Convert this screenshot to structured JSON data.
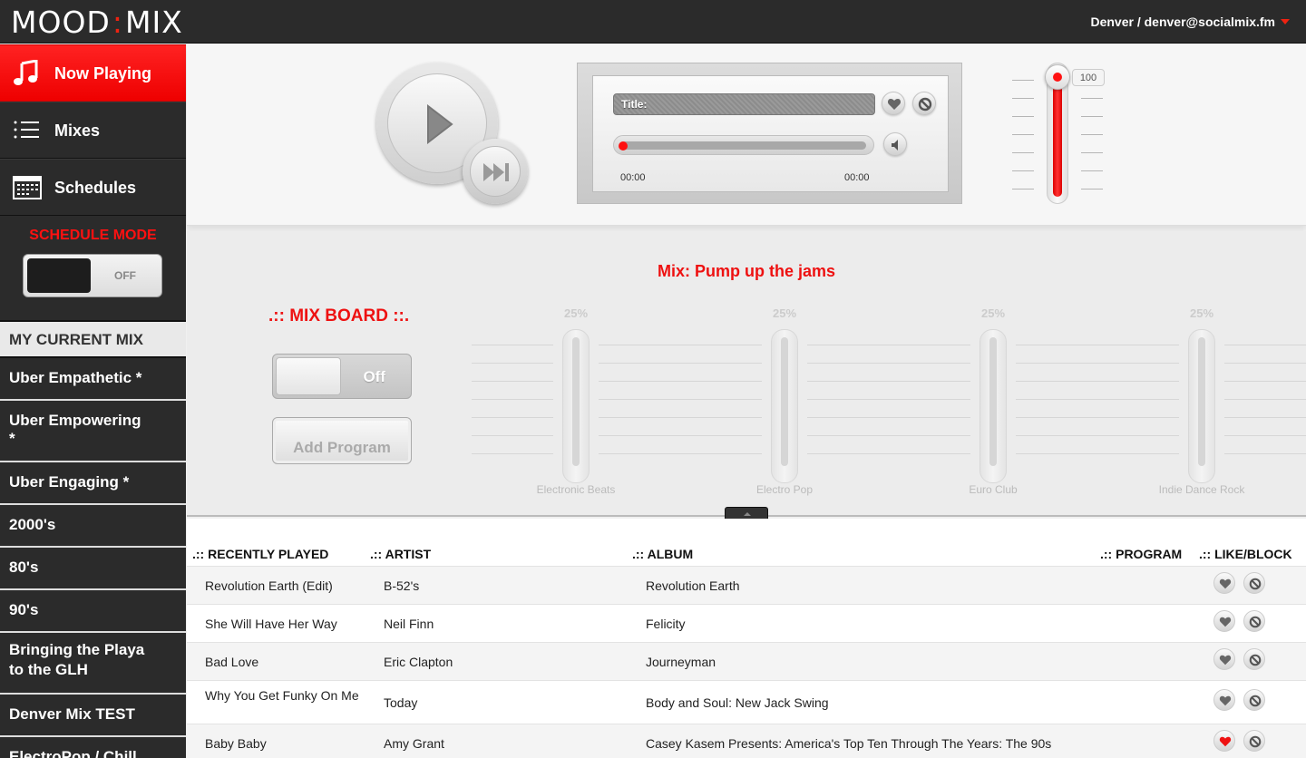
{
  "header": {
    "logo_left": "MOOD",
    "logo_sep": ":",
    "logo_right": "MIX",
    "user": "Denver / denver@socialmix.fm"
  },
  "sidebar": {
    "nav": [
      {
        "label": "Now Playing",
        "icon": "music-note-icon"
      },
      {
        "label": "Mixes",
        "icon": "list-icon"
      },
      {
        "label": "Schedules",
        "icon": "calendar-icon"
      }
    ],
    "schedule_mode": {
      "title": "SCHEDULE MODE",
      "state": "OFF"
    },
    "current_mix_heading": "MY CURRENT MIX",
    "mixes": [
      "Uber Empathetic *",
      "Uber Empowering *",
      "Uber Engaging *",
      "2000's",
      "80's",
      "90's",
      "Bringing the Playa to the GLH",
      "Denver Mix TEST",
      "ElectroPop / Chill"
    ]
  },
  "player": {
    "title_label": "Title:",
    "time_start": "00:00",
    "time_end": "00:00",
    "volume": "100",
    "accent_color": "#ee1111"
  },
  "mixboard": {
    "mix_title": "Mix: Pump up the jams",
    "board_title": ".:: MIX BOARD ::.",
    "toggle_state": "Off",
    "add_program": "Add Program",
    "faders": [
      {
        "name": "Electronic Beats",
        "percent": "25%"
      },
      {
        "name": "Electro Pop",
        "percent": "25%"
      },
      {
        "name": "Euro Club",
        "percent": "25%"
      },
      {
        "name": "Indie Dance Rock",
        "percent": "25%"
      }
    ]
  },
  "table": {
    "headers": {
      "recent": ".:: RECENTLY PLAYED",
      "artist": ".:: ARTIST",
      "album": ".:: ALBUM",
      "program": ".:: PROGRAM",
      "like_block": ".:: LIKE/BLOCK"
    },
    "rows": [
      {
        "title": "Revolution Earth (Edit)",
        "artist": "B-52's",
        "album": "Revolution Earth",
        "liked": false
      },
      {
        "title": "She Will Have Her Way",
        "artist": "Neil Finn",
        "album": "Felicity",
        "liked": false
      },
      {
        "title": "Bad Love",
        "artist": "Eric Clapton",
        "album": "Journeyman",
        "liked": false
      },
      {
        "title": "Why You Get Funky On Me",
        "artist": "Today",
        "album": "Body and Soul: New Jack Swing",
        "liked": false
      },
      {
        "title": "Baby Baby",
        "artist": "Amy Grant",
        "album": "Casey Kasem Presents: America's Top Ten Through The Years: The 90s",
        "liked": true
      }
    ]
  }
}
